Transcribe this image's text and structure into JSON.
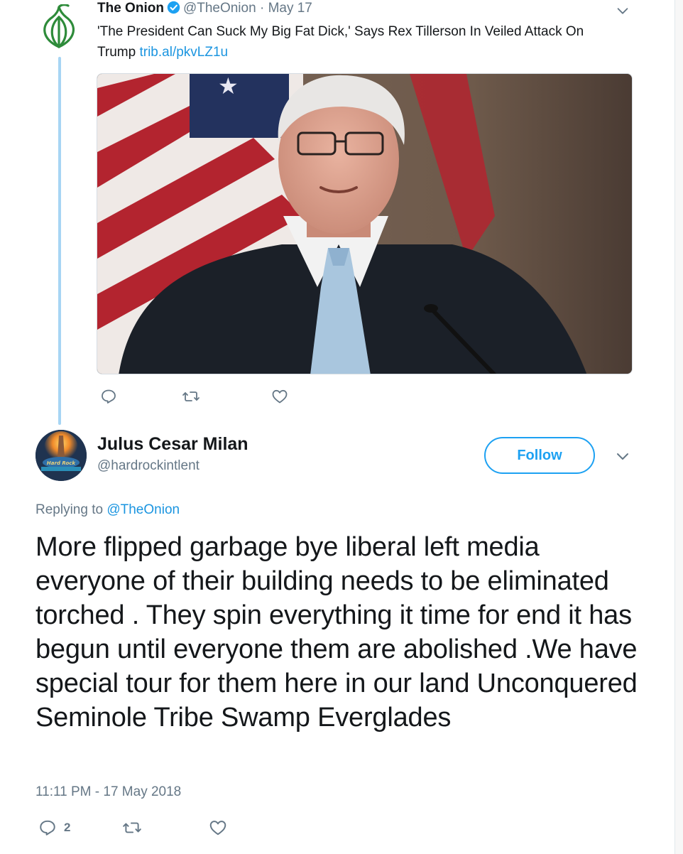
{
  "parent_tweet": {
    "author_name": "The Onion",
    "handle": "@TheOnion",
    "separator": "·",
    "date": "May 17",
    "text": "'The President Can Suck My Big Fat Dick,' Says Rex Tillerson In Veiled Attack On Trump",
    "link": "trib.al/pkvLZ1u",
    "actions": {
      "reply_count": "",
      "retweet_count": "",
      "like_count": ""
    }
  },
  "reply_tweet": {
    "author_name": "Julus Cesar Milan",
    "handle": "@hardrockintlent",
    "follow_label": "Follow",
    "replying_prefix": "Replying to",
    "replying_to": "@TheOnion",
    "text": "More flipped garbage bye liberal left media everyone of their building needs to be eliminated torched . They spin everything it time for end it has begun until everyone them are abolished .We have special tour for them here in our land Unconquered Seminole Tribe Swamp Everglades",
    "timestamp": "11:11 PM - 17 May 2018",
    "actions": {
      "reply_count": "2",
      "retweet_count": "",
      "like_count": ""
    }
  },
  "colors": {
    "link": "#1b95e0",
    "accent": "#1da1f2",
    "muted": "#657786",
    "thread_line": "#a7d5f4",
    "onion_green": "#2e8b3a"
  },
  "icons": [
    "onion-logo-icon",
    "verified-badge-icon",
    "chevron-down-icon",
    "reply-icon",
    "retweet-icon",
    "like-icon"
  ]
}
